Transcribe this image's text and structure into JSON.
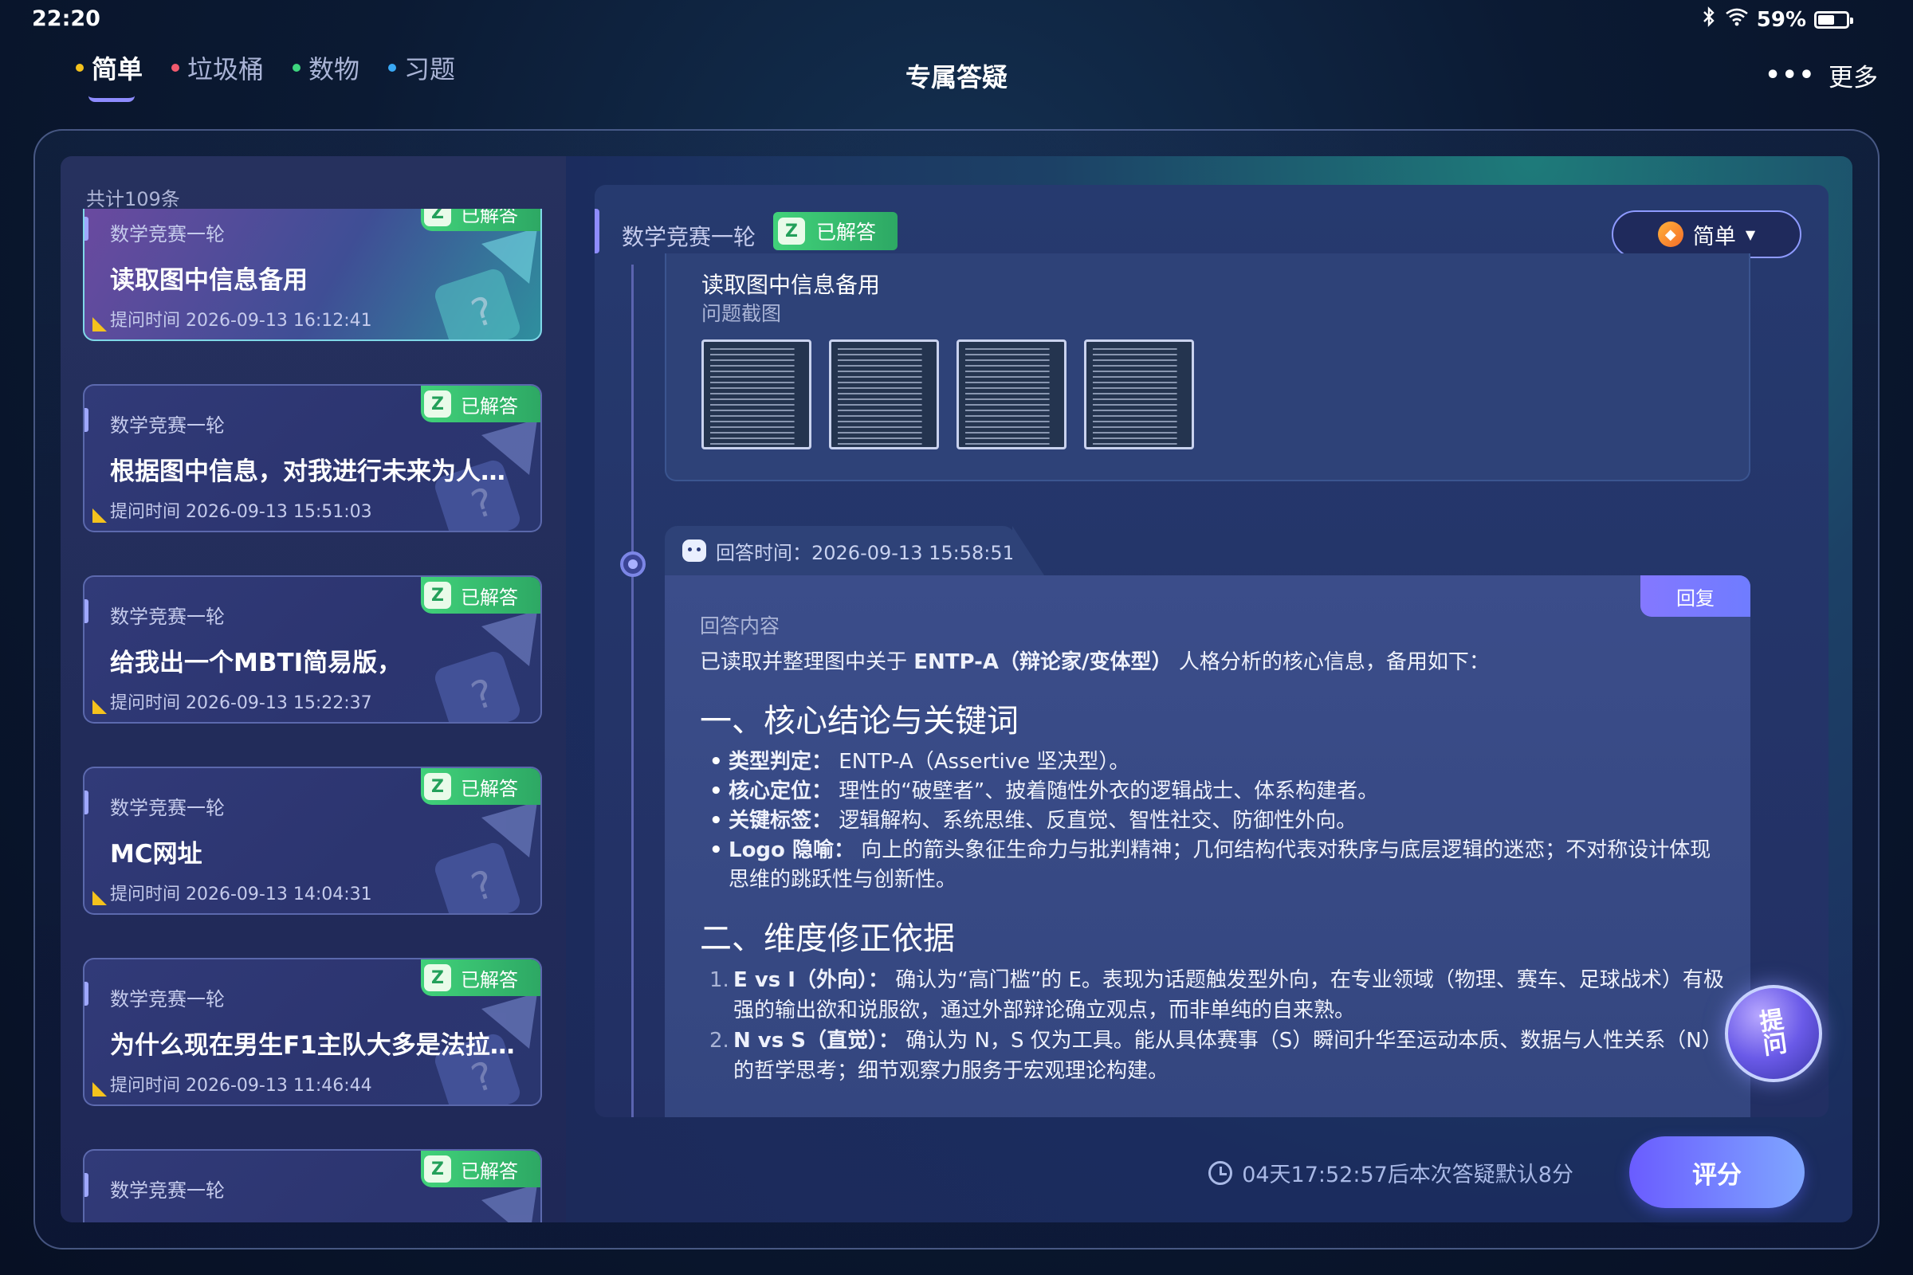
{
  "status_bar": {
    "time": "22:20",
    "battery": "59%",
    "battery_level": 0.59
  },
  "nav": {
    "tabs": [
      {
        "label": "简单",
        "dot_color": "#f4c21d",
        "active": true
      },
      {
        "label": "垃圾桶",
        "dot_color": "#f25a6e",
        "active": false
      },
      {
        "label": "数物",
        "dot_color": "#3ed67f",
        "active": false
      },
      {
        "label": "习题",
        "dot_color": "#3aa9f5",
        "active": false
      }
    ],
    "title": "专属答疑",
    "more_label": "更多"
  },
  "list": {
    "count_text": "共计109条",
    "items": [
      {
        "category": "数学竞赛一轮",
        "title": "读取图中信息备用",
        "time": "提问时间 2026-09-13 16:12:41",
        "badge": "已解答",
        "active": true
      },
      {
        "category": "数学竞赛一轮",
        "title": "根据图中信息，对我进行未来为人规划",
        "time": "提问时间 2026-09-13 15:51:03",
        "badge": "已解答",
        "active": false
      },
      {
        "category": "数学竞赛一轮",
        "title": "给我出一个MBTI简易版，",
        "time": "提问时间 2026-09-13 15:22:37",
        "badge": "已解答",
        "active": false
      },
      {
        "category": "数学竞赛一轮",
        "title": "MC网址",
        "time": "提问时间 2026-09-13 14:04:31",
        "badge": "已解答",
        "active": false
      },
      {
        "category": "数学竞赛一轮",
        "title": "为什么现在男生F1主队大多是法拉利…",
        "time": "提问时间 2026-09-13 11:46:44",
        "badge": "已解答",
        "active": false
      },
      {
        "category": "数学竞赛一轮",
        "title": "",
        "time": "",
        "badge": "已解答",
        "active": false
      }
    ]
  },
  "detail": {
    "category": "数学竞赛一轮",
    "badge": "已解答",
    "level": "简单",
    "question_title": "读取图中信息备用",
    "screenshot_label": "问题截图",
    "answer_time": "回答时间：2026-09-13 15:58:51",
    "reply_label": "回复",
    "answer_label": "回答内容",
    "answer_intro_before": "已读取并整理图中关于",
    "answer_intro_bold": "ENTP-A（辩论家/变体型）",
    "answer_intro_after": "人格分析的核心信息，备用如下：",
    "section1_heading": "一、核心结论与关键词",
    "section1_items": [
      {
        "key": "类型判定：",
        "text": "ENTP-A（Assertive 坚决型）。"
      },
      {
        "key": "核心定位：",
        "text": "理性的“破壁者”、披着随性外衣的逻辑战士、体系构建者。"
      },
      {
        "key": "关键标签：",
        "text": "逻辑解构、系统思维、反直觉、智性社交、防御性外向。"
      },
      {
        "key": "Logo 隐喻：",
        "text": "向上的箭头象征生命力与批判精神；几何结构代表对秩序与底层逻辑的迷恋；不对称设计体现思维的跳跃性与创新性。"
      }
    ],
    "section2_heading": "二、维度修正依据",
    "section2_items": [
      {
        "num": "1.",
        "key": "E vs I（外向）：",
        "text": "确认为“高门槛”的 E。表现为话题触发型外向，在专业领域（物理、赛车、足球战术）有极强的输出欲和说服欲，通过外部辩论确立观点，而非单纯的自来熟。"
      },
      {
        "num": "2.",
        "key": "N vs S（直觉）：",
        "text": "确认为 N，S 仅为工具。能从具体赛事（S）瞬间升华至运动本质、数据与人性关系（N）的哲学思考；细节观察力服务于宏观理论构建。"
      }
    ],
    "ask_label": "提问"
  },
  "footer": {
    "countdown": "04天17:52:57后本次答疑默认8分",
    "rate_label": "评分"
  },
  "colors": {
    "accent": "#8e8cff",
    "answered_green": "#2da864",
    "marker_yellow": "#f4c21d"
  }
}
